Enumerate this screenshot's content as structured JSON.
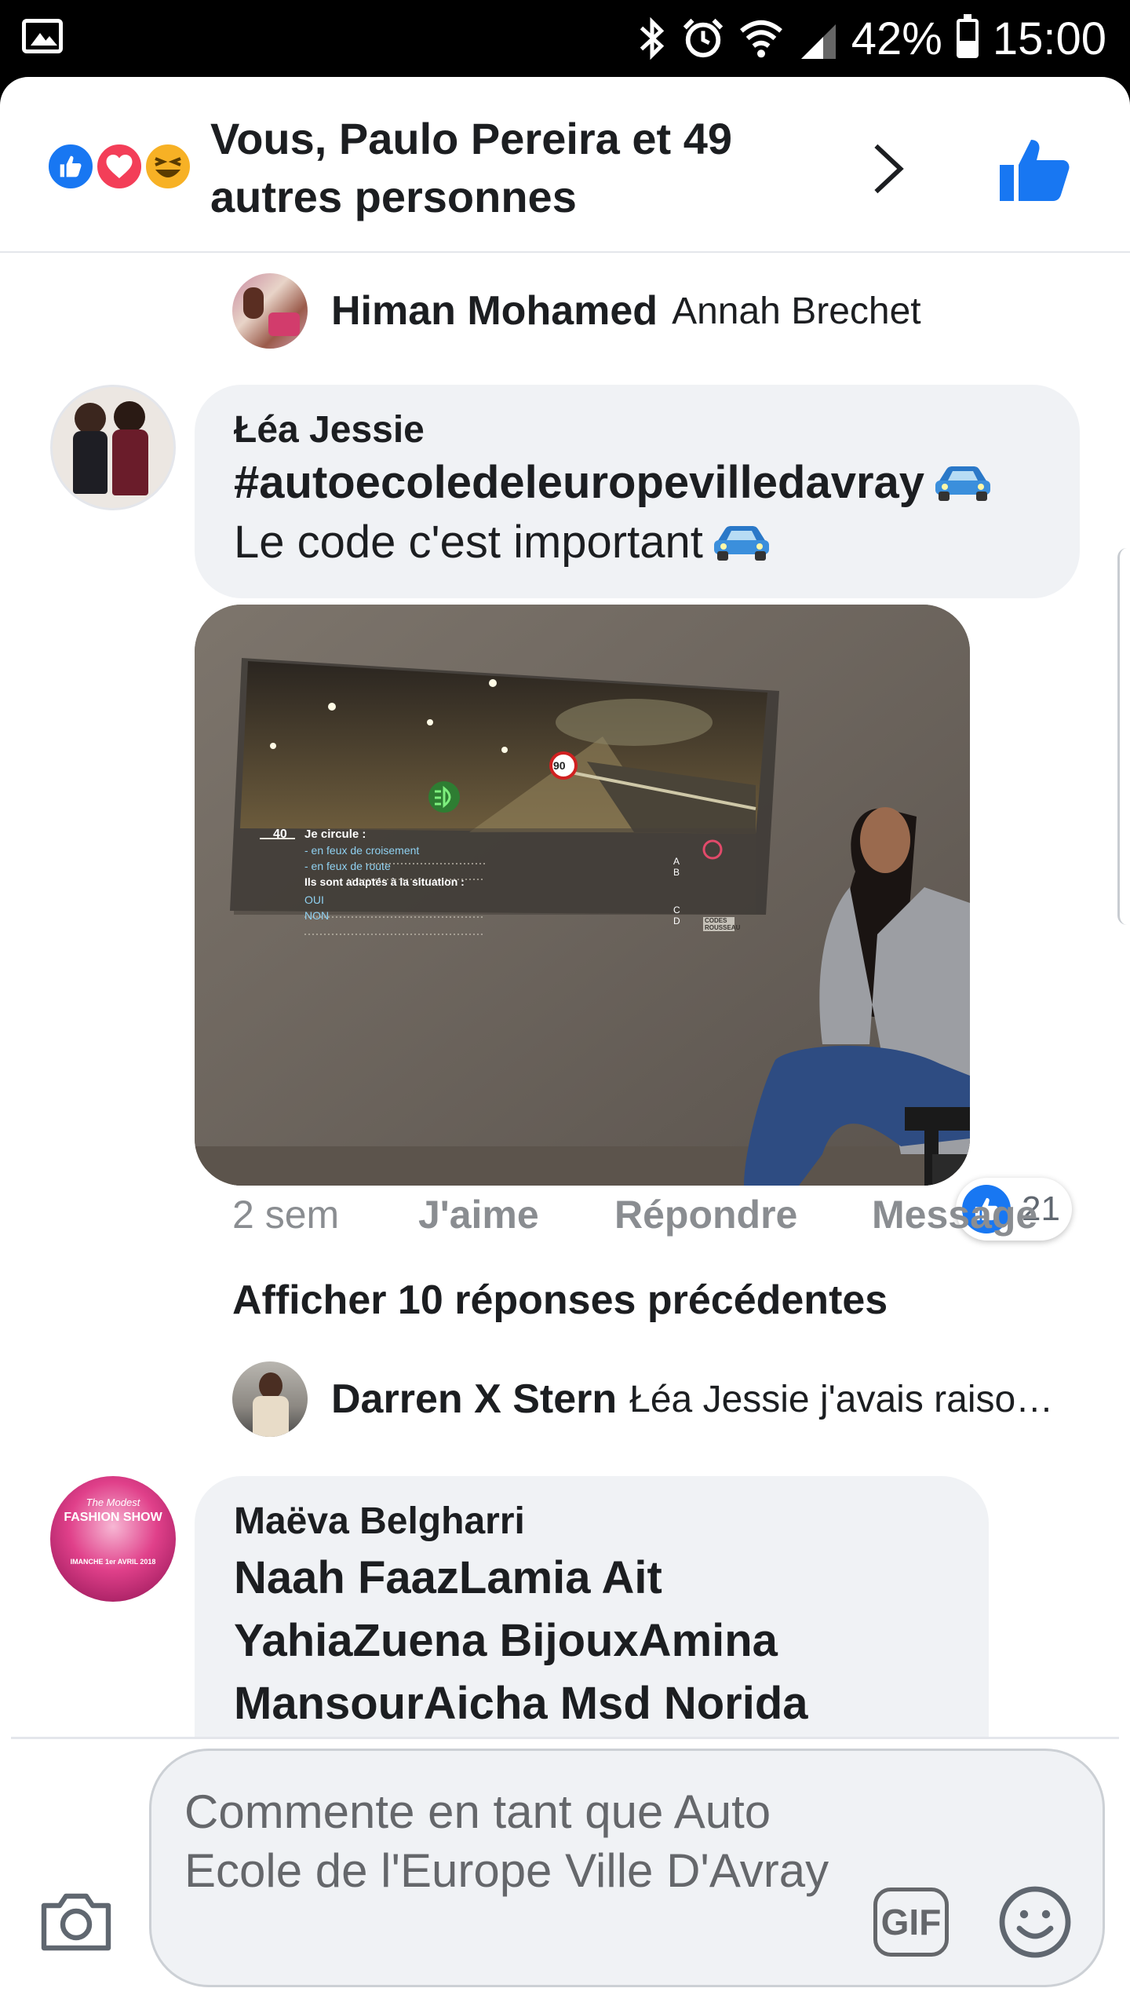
{
  "status_bar": {
    "battery": "42%",
    "time": "15:00",
    "icons": [
      "gallery-icon",
      "bluetooth-icon",
      "alarm-icon",
      "wifi-icon",
      "signal-icon",
      "battery-icon"
    ]
  },
  "reactions_header": {
    "reaction_icons": [
      "like-icon",
      "love-icon",
      "haha-icon"
    ],
    "text": "Vous, Paulo Pereira et 49 autres personnes"
  },
  "comments": [
    {
      "type": "reply-preview",
      "name": "Himan Mohamed",
      "text": "Annah Brechet"
    },
    {
      "type": "comment",
      "name": "Łéa Jessie",
      "lines": [
        "#autoecoledeleuropevilledavray",
        "Le code c'est important"
      ],
      "emoji": "car-icon",
      "photo": {
        "question_number": "40",
        "question_title": "Je circule :",
        "option_a": "- en feux de croisement",
        "option_b": "- en feux de route",
        "question_2": "Ils sont adaptés à la situation :",
        "option_c": "OUI",
        "option_d": "NON",
        "letters": [
          "A",
          "B",
          "C",
          "D"
        ],
        "speed_sign": "90",
        "brand": "CODES ROUSSEAU"
      },
      "likes": "21",
      "time": "2 sem",
      "actions": [
        "J'aime",
        "Répondre",
        "Message"
      ]
    }
  ],
  "show_more": "Afficher 10 réponses précédentes",
  "reply_2": {
    "name": "Darren X Stern",
    "text": "Łéa Jessie j'avais raiso…"
  },
  "comment_3": {
    "name": "Maëva Belgharri",
    "lines": [
      "Naah FaazLamia Ait",
      "YahiaZuena BijouxAmina",
      "MansourAicha Msd Norida"
    ],
    "avatar_text": [
      "The Modest",
      "FASHION SHOW",
      "IMANCHE 1er AVRIL 2018"
    ]
  },
  "composer": {
    "placeholder": "Commente en tant que Auto Ecole de l'Europe Ville D'Avray",
    "gif_label": "GIF"
  },
  "colors": {
    "facebook_blue": "#1877f2",
    "love_red": "#f33e58",
    "haha_yellow": "#f7b125",
    "bubble_gray": "#f0f2f5",
    "meta_gray": "#8a8d91"
  }
}
